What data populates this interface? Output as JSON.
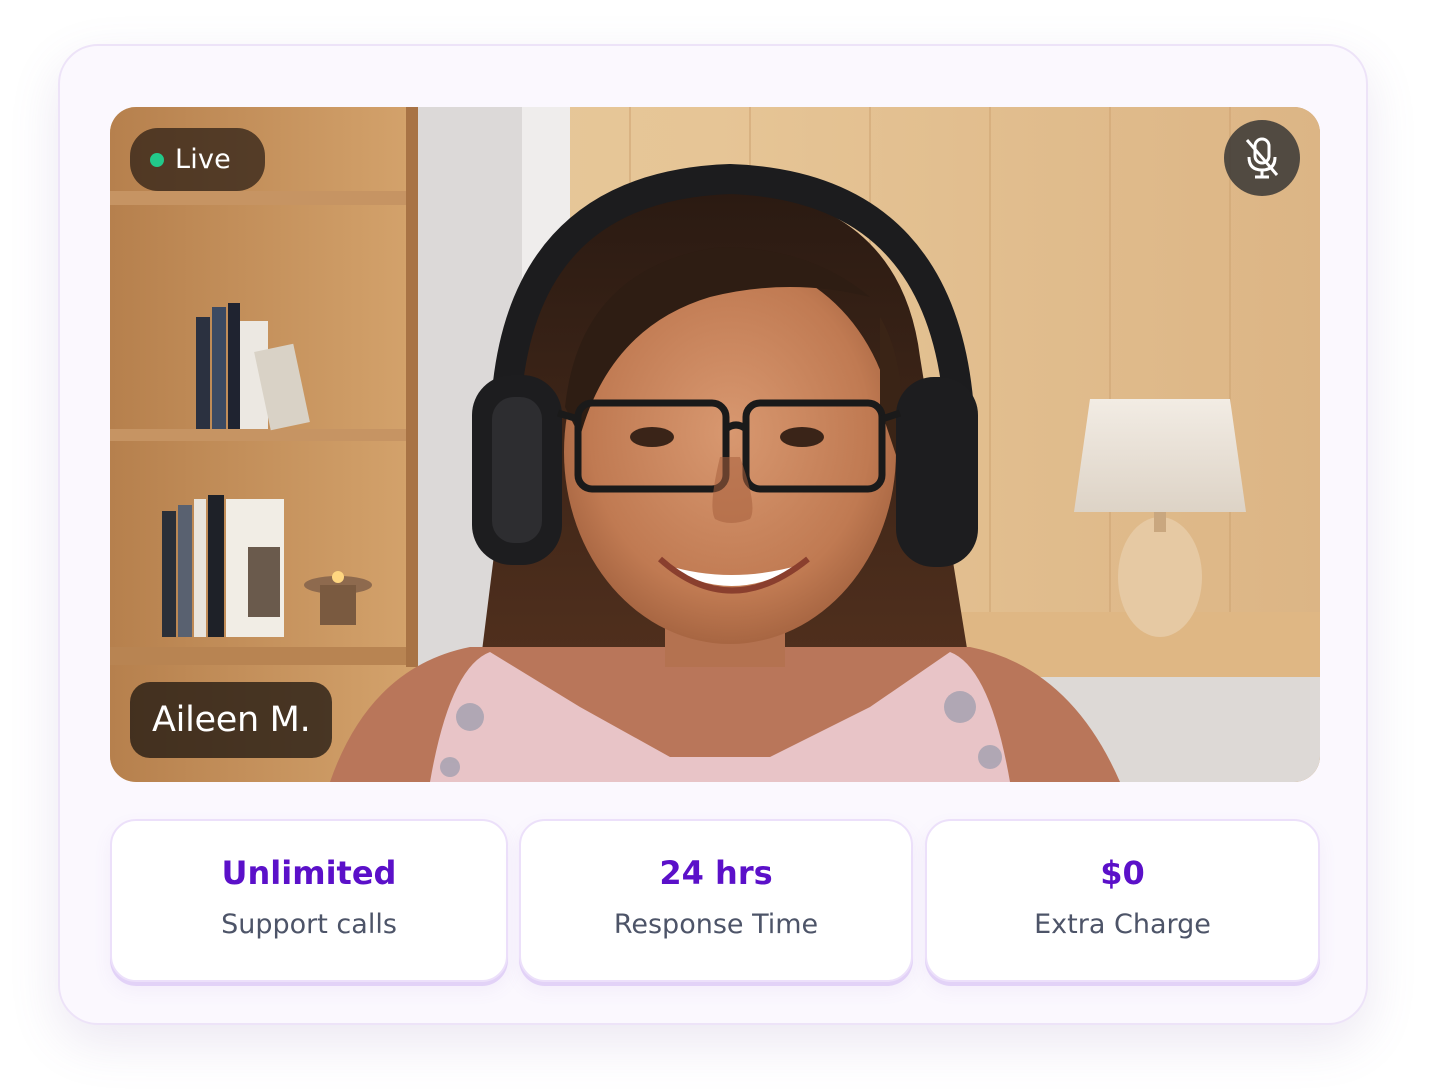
{
  "call": {
    "status_label": "Live",
    "participant_name": "Aileen M.",
    "mic_state_icon": "mic-off-icon",
    "status_color": "#22c98a"
  },
  "stats": [
    {
      "value": "Unlimited",
      "label": "Support calls"
    },
    {
      "value": "24 hrs",
      "label": "Response Time"
    },
    {
      "value": "$0",
      "label": "Extra Charge"
    }
  ],
  "colors": {
    "accent": "#5b10c9",
    "label": "#4d5468"
  }
}
